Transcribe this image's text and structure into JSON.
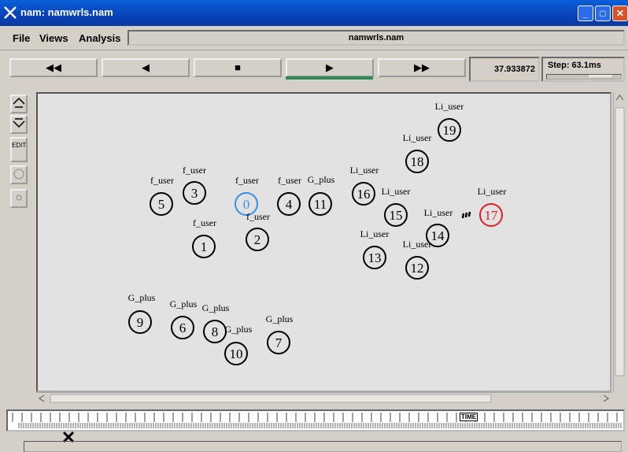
{
  "window": {
    "title": "nam: namwrls.nam",
    "buttons": [
      "_",
      "□",
      "✕"
    ]
  },
  "menubar": {
    "file": "File",
    "views": "Views",
    "analysis": "Analysis",
    "filename": "namwrls.nam"
  },
  "controls": {
    "rewind": "◀◀",
    "back": "◀",
    "stop": "■",
    "play": "▶",
    "fast_forward": "▶▶",
    "time": "37.933872",
    "step": "Step: 63.1ms"
  },
  "leftpanel": {
    "edit": "EDIT"
  },
  "timeline": {
    "label": "TIME"
  },
  "colors": {
    "node_default": "#000000",
    "node_highlight_blue": "#3a8ee6",
    "node_highlight_red": "#e02020"
  },
  "nodes": [
    {
      "id": "0",
      "label": "f_user",
      "color": "#3a8ee6"
    },
    {
      "id": "1",
      "label": "f_user",
      "color": "#000000"
    },
    {
      "id": "2",
      "label": "f_user",
      "color": "#000000"
    },
    {
      "id": "3",
      "label": "f_user",
      "color": "#000000"
    },
    {
      "id": "4",
      "label": "f_user",
      "color": "#000000"
    },
    {
      "id": "5",
      "label": "f_user",
      "color": "#000000"
    },
    {
      "id": "6",
      "label": "G_plus",
      "color": "#000000"
    },
    {
      "id": "7",
      "label": "G_plus",
      "color": "#000000"
    },
    {
      "id": "8",
      "label": "G_plus",
      "color": "#000000"
    },
    {
      "id": "9",
      "label": "G_plus",
      "color": "#000000"
    },
    {
      "id": "10",
      "label": "G_plus",
      "color": "#000000"
    },
    {
      "id": "11",
      "label": "G_plus",
      "color": "#000000"
    },
    {
      "id": "12",
      "label": "Li_user",
      "color": "#000000"
    },
    {
      "id": "13",
      "label": "Li_user",
      "color": "#000000"
    },
    {
      "id": "14",
      "label": "Li_user",
      "color": "#000000"
    },
    {
      "id": "15",
      "label": "Li_user",
      "color": "#000000"
    },
    {
      "id": "16",
      "label": "Li_user",
      "color": "#000000"
    },
    {
      "id": "17",
      "label": "Li_user",
      "color": "#e02020"
    },
    {
      "id": "18",
      "label": "Li_user",
      "color": "#000000"
    },
    {
      "id": "19",
      "label": "Li_user",
      "color": "#000000"
    }
  ]
}
